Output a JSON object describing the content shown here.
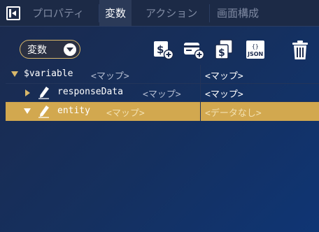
{
  "tabs": [
    {
      "label": "プロパティ",
      "active": false
    },
    {
      "label": "変数",
      "active": true
    },
    {
      "label": "アクション",
      "active": false
    },
    {
      "label": "画面構成",
      "active": false
    }
  ],
  "toolbar": {
    "scope_dropdown": {
      "value": "変数"
    },
    "icons": [
      "add-variable-icon",
      "add-card-icon",
      "copy-variable-icon",
      "json-icon",
      "trash-icon"
    ],
    "json_icon_text": "JSON"
  },
  "tree": {
    "rows": [
      {
        "key": "$variable",
        "type": "<マップ>",
        "value": "<マップ>",
        "expanded": true,
        "level": 0
      },
      {
        "key": "responseData",
        "type": "<マップ>",
        "value": "<マップ>",
        "expanded": false,
        "level": 1
      },
      {
        "key": "entity",
        "type": "<マップ>",
        "value": "<データなし>",
        "expanded": true,
        "level": 1,
        "selected": true
      }
    ]
  },
  "colors": {
    "accent": "#d9b86a",
    "selected_row": "#d2a84f",
    "tab_bg": "#1c2a46",
    "active_tab_bg": "#2b3a58"
  }
}
